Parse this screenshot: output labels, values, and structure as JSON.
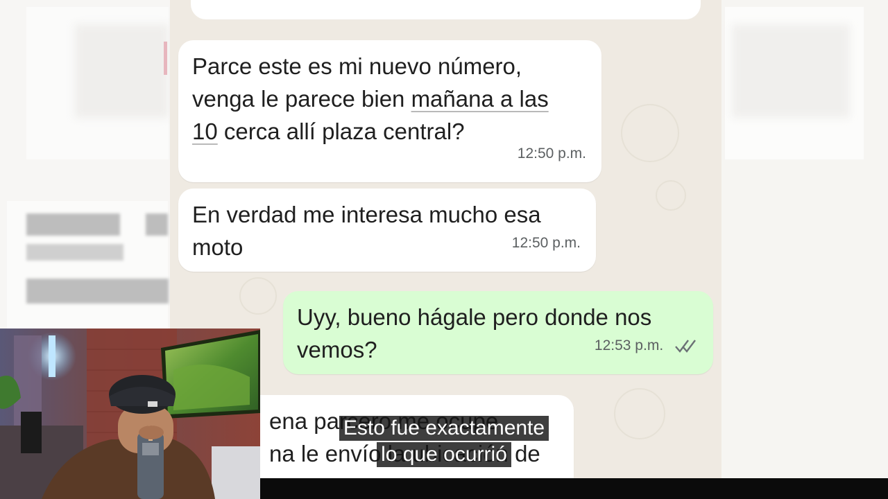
{
  "chat": {
    "messages": [
      {
        "direction": "incoming",
        "lines": [
          "Parce este es mi nuevo número,",
          "venga le parece bien ",
          "mañana a las",
          "10",
          " cerca allí plaza central?"
        ],
        "time": "12:50 p.m."
      },
      {
        "direction": "incoming",
        "lines": [
          "En verdad me interesa mucho esa",
          "moto"
        ],
        "time": "12:50 p.m."
      },
      {
        "direction": "outgoing",
        "lines": [
          "Uyy, bueno hágale pero donde nos",
          "vemos?"
        ],
        "time": "12:53 p.m.",
        "status_icon": "double-check-icon"
      },
      {
        "direction": "incoming",
        "lines": [
          "ena parcero me ocupe",
          "na le envío la ubicación de"
        ],
        "time": ""
      }
    ]
  },
  "subtitle": {
    "line1": "Esto fue exactamente",
    "line2": "lo que ocurrió"
  },
  "colors": {
    "chat_bg": "#efeae2",
    "incoming_bubble": "#ffffff",
    "outgoing_bubble": "#d9fdd3",
    "time_text": "#5b5f61"
  }
}
